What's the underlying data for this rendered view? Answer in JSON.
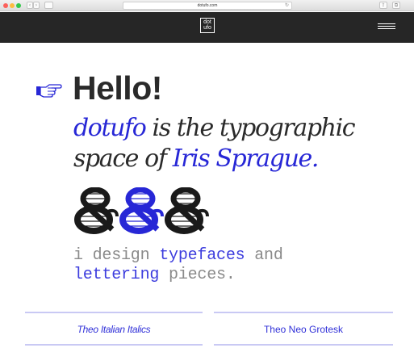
{
  "browser": {
    "address": "dotufo.com",
    "reload_glyph": "↻",
    "back_glyph": "‹",
    "forward_glyph": "›",
    "share_glyph": "⇪",
    "tabs_glyph": "⧉"
  },
  "header": {
    "logo_line1": "dot",
    "logo_line2": "ufo",
    "background": "#262626"
  },
  "hero": {
    "heading": "Hello!",
    "intro_part1": "dotufo",
    "intro_part2": " is the typographic space of ",
    "intro_part3": "Iris Sprague."
  },
  "design_line": {
    "part1": "i design ",
    "part2": "typefaces",
    "part3": " and",
    "part4": "lettering",
    "part5": " pieces."
  },
  "cards": [
    {
      "label": "Theo Italian Italics"
    },
    {
      "label": "Theo Neo Grotesk"
    }
  ],
  "colors": {
    "accent": "#2727d6",
    "text": "#2a2a2a",
    "muted": "#8a8a8a",
    "card_rule": "#c9c9f4"
  },
  "icons": [
    "pointing-hand-icon",
    "hamburger-menu-icon",
    "ampersand-glyph-icon"
  ]
}
